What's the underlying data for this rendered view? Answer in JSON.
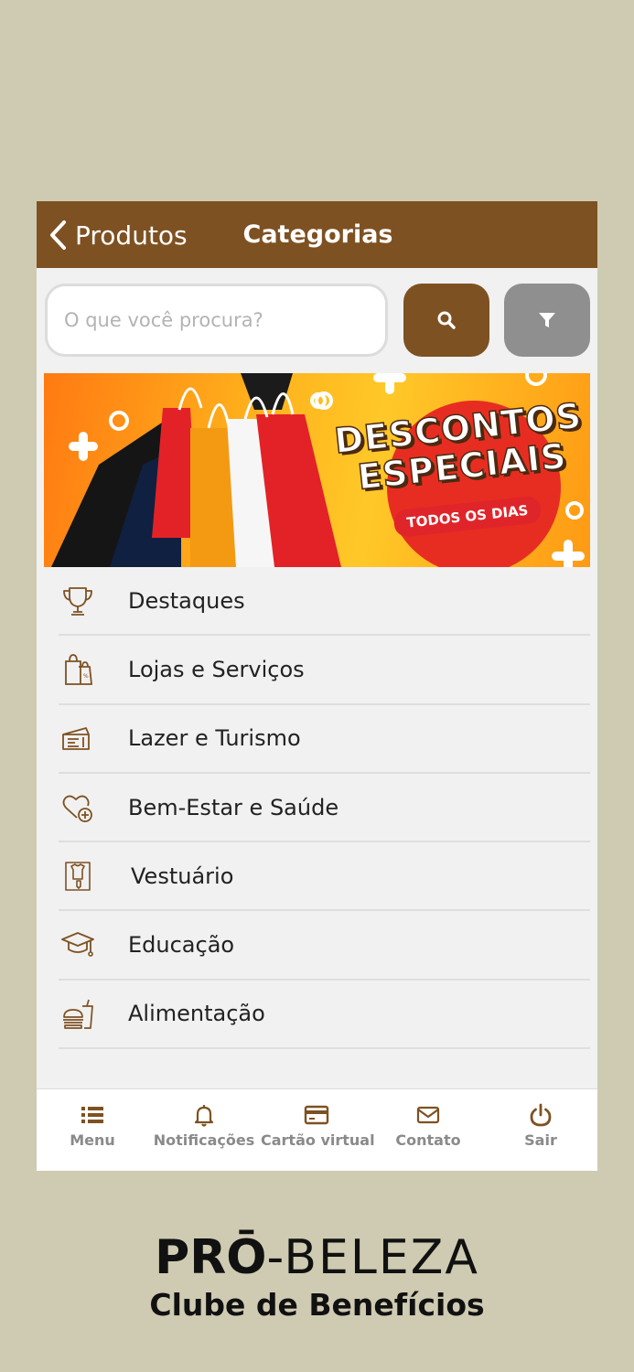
{
  "header": {
    "back_label": "Produtos",
    "title": "Categorias"
  },
  "search": {
    "placeholder": "O que você procura?",
    "value": ""
  },
  "banner": {
    "line1": "DESCONTOS",
    "line2": "ESPECIAIS",
    "pill": "TODOS OS DIAS"
  },
  "categories": [
    {
      "label": "Destaques",
      "icon": "trophy-icon"
    },
    {
      "label": "Lojas e Serviços",
      "icon": "shopping-bag-icon"
    },
    {
      "label": "Lazer e Turismo",
      "icon": "ticket-icon"
    },
    {
      "label": "Bem-Estar e Saúde",
      "icon": "heart-plus-icon"
    },
    {
      "label": "Vestuário",
      "icon": "shirt-tag-icon"
    },
    {
      "label": "Educação",
      "icon": "graduation-cap-icon"
    },
    {
      "label": "Alimentação",
      "icon": "food-icon"
    }
  ],
  "tabbar": {
    "items": [
      {
        "label": "Menu",
        "icon": "list-icon"
      },
      {
        "label": "Notificações",
        "icon": "bell-icon"
      },
      {
        "label": "Cartão virtual",
        "icon": "card-icon"
      },
      {
        "label": "Contato",
        "icon": "envelope-icon"
      },
      {
        "label": "Sair",
        "icon": "power-icon"
      }
    ]
  },
  "brand": {
    "name_bold": "PRŌ",
    "name_thin": "-BELEZA",
    "tagline": "Clube de Benefícios"
  },
  "colors": {
    "primary": "#7e5122",
    "filter_button": "#8f8f8f",
    "background": "#cfcbb2",
    "tab_inactive": "#8a8a8a"
  }
}
